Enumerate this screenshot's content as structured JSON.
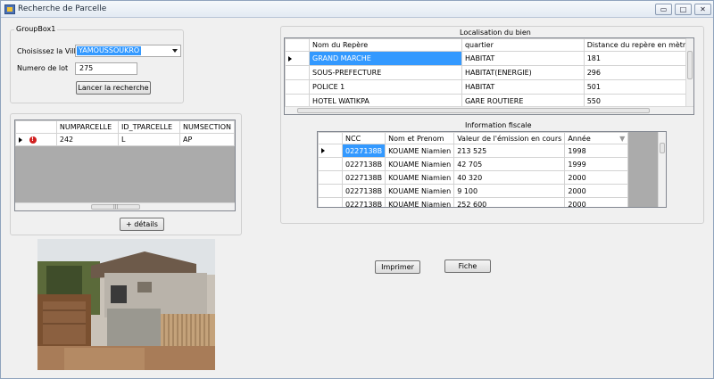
{
  "window": {
    "title": "Recherche de Parcelle",
    "buttons": {
      "minimize": "▭",
      "maximize": "□",
      "close": "✕"
    }
  },
  "search": {
    "group_label": "GroupBox1",
    "city_label": "Choisissez la Ville",
    "city_value": "YAMOUSSOUKRO",
    "lot_label": "Numero de lot",
    "lot_value": "275",
    "search_button": "Lancer la recherche"
  },
  "parcel_grid": {
    "headers": [
      "NUMPARCELLE",
      "ID_TPARCELLE",
      "NUMSECTION"
    ],
    "rows": [
      [
        "242",
        "L",
        "AP"
      ]
    ],
    "details_button": "+ détails"
  },
  "location": {
    "label": "Localisation du bien",
    "headers": [
      "Nom du Repère",
      "quartier",
      "Distance du repère en mètre"
    ],
    "rows": [
      [
        "GRAND MARCHE",
        "HABITAT",
        "181"
      ],
      [
        "SOUS-PREFECTURE",
        "HABITAT(ENERGIE)",
        "296"
      ],
      [
        "POLICE 1",
        "HABITAT",
        "501"
      ],
      [
        "HOTEL WATIKPA",
        "GARE ROUTIERE",
        "550"
      ]
    ]
  },
  "fiscal": {
    "label": "Information fiscale",
    "headers": [
      "NCC",
      "Nom et Prenom",
      "Valeur de l'émission en cours",
      "Année"
    ],
    "rows": [
      [
        "0227138B",
        "KOUAME Niamien",
        "213 525",
        "1998"
      ],
      [
        "0227138B",
        "KOUAME Niamien",
        "42 705",
        "1999"
      ],
      [
        "0227138B",
        "KOUAME Niamien",
        "40 320",
        "2000"
      ],
      [
        "0227138B",
        "KOUAME Niamien",
        "9 100",
        "2000"
      ],
      [
        "0227138B",
        "KOUAME Niamien",
        "252 600",
        "2000"
      ]
    ]
  },
  "actions": {
    "print_button": "Imprimer",
    "sheet_button": "Fiche"
  },
  "colors": {
    "selection": "#3399ff",
    "grid_background": "#ababab",
    "window_background": "#f0f0f0"
  }
}
